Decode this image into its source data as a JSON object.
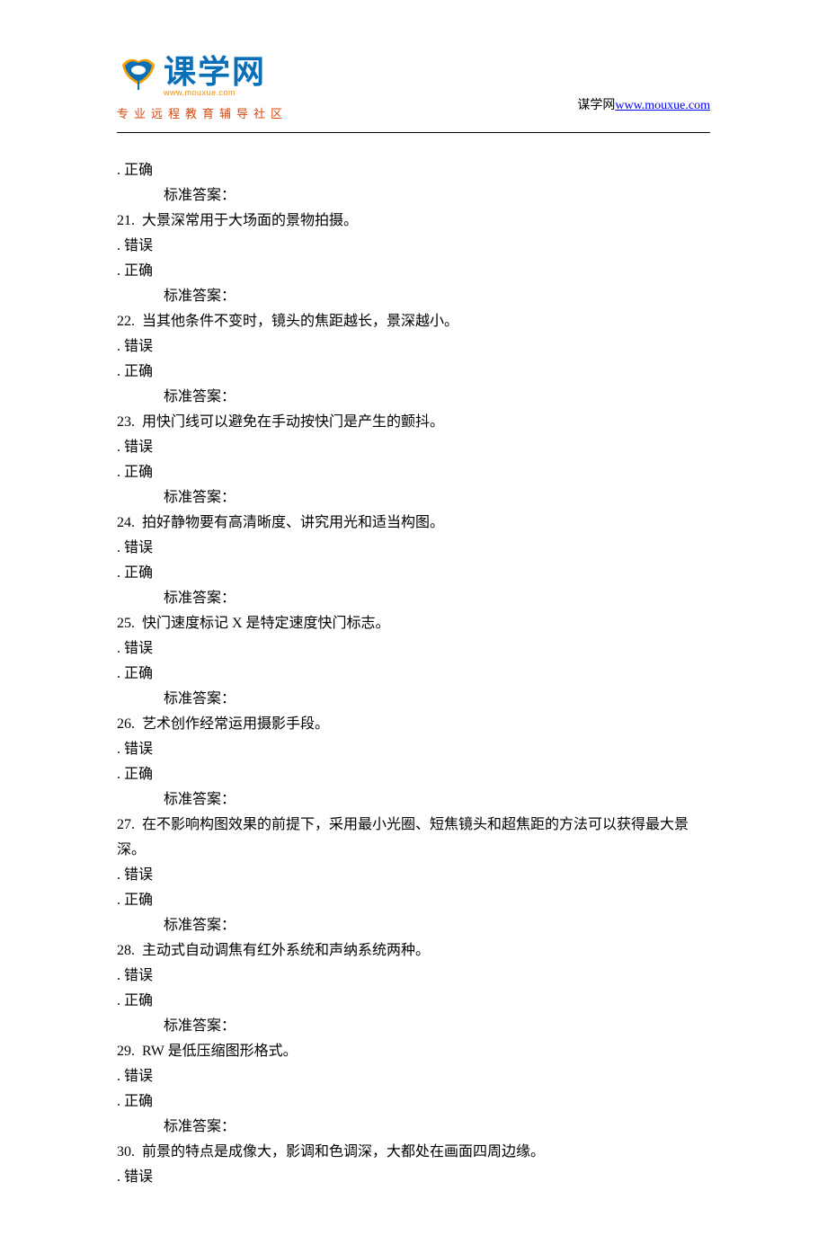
{
  "header": {
    "logo_main": "课学网",
    "logo_url": "www.mouxue.com",
    "tagline": "专业远程教育辅导社区",
    "site_label": "谋学网",
    "site_link": "www.mouxue.com"
  },
  "pre": [
    ". 正确",
    "     标准答案："
  ],
  "questions": [
    {
      "num": "21.",
      "text": "  大景深常用于大场面的景物拍摄。",
      "opts": [
        ". 错误",
        ". 正确"
      ],
      "ans": "     标准答案："
    },
    {
      "num": "22.",
      "text": "  当其他条件不变时，镜头的焦距越长，景深越小。",
      "opts": [
        ". 错误",
        ". 正确"
      ],
      "ans": "     标准答案："
    },
    {
      "num": "23.",
      "text": "  用快门线可以避免在手动按快门是产生的颤抖。",
      "opts": [
        ". 错误",
        ". 正确"
      ],
      "ans": "     标准答案："
    },
    {
      "num": "24.",
      "text": "  拍好静物要有高清晰度、讲究用光和适当构图。",
      "opts": [
        ". 错误",
        ". 正确"
      ],
      "ans": "     标准答案："
    },
    {
      "num": "25.",
      "text": "  快门速度标记 X 是特定速度快门标志。",
      "opts": [
        ". 错误",
        ". 正确"
      ],
      "ans": "     标准答案："
    },
    {
      "num": "26.",
      "text": "  艺术创作经常运用摄影手段。",
      "opts": [
        ". 错误",
        ". 正确"
      ],
      "ans": "     标准答案："
    },
    {
      "num": "27.",
      "text": "  在不影响构图效果的前提下，采用最小光圈、短焦镜头和超焦距的方法可以获得最大景深。",
      "opts": [
        ". 错误",
        ". 正确"
      ],
      "ans": "     标准答案："
    },
    {
      "num": "28.",
      "text": "  主动式自动调焦有红外系统和声纳系统两种。",
      "opts": [
        ". 错误",
        ". 正确"
      ],
      "ans": "     标准答案："
    },
    {
      "num": "29.",
      "text": "  RW 是低压缩图形格式。",
      "opts": [
        ". 错误",
        ". 正确"
      ],
      "ans": "     标准答案："
    },
    {
      "num": "30.",
      "text": "  前景的特点是成像大，影调和色调深，大都处在画面四周边缘。",
      "opts": [
        ". 错误"
      ],
      "ans": null
    }
  ]
}
